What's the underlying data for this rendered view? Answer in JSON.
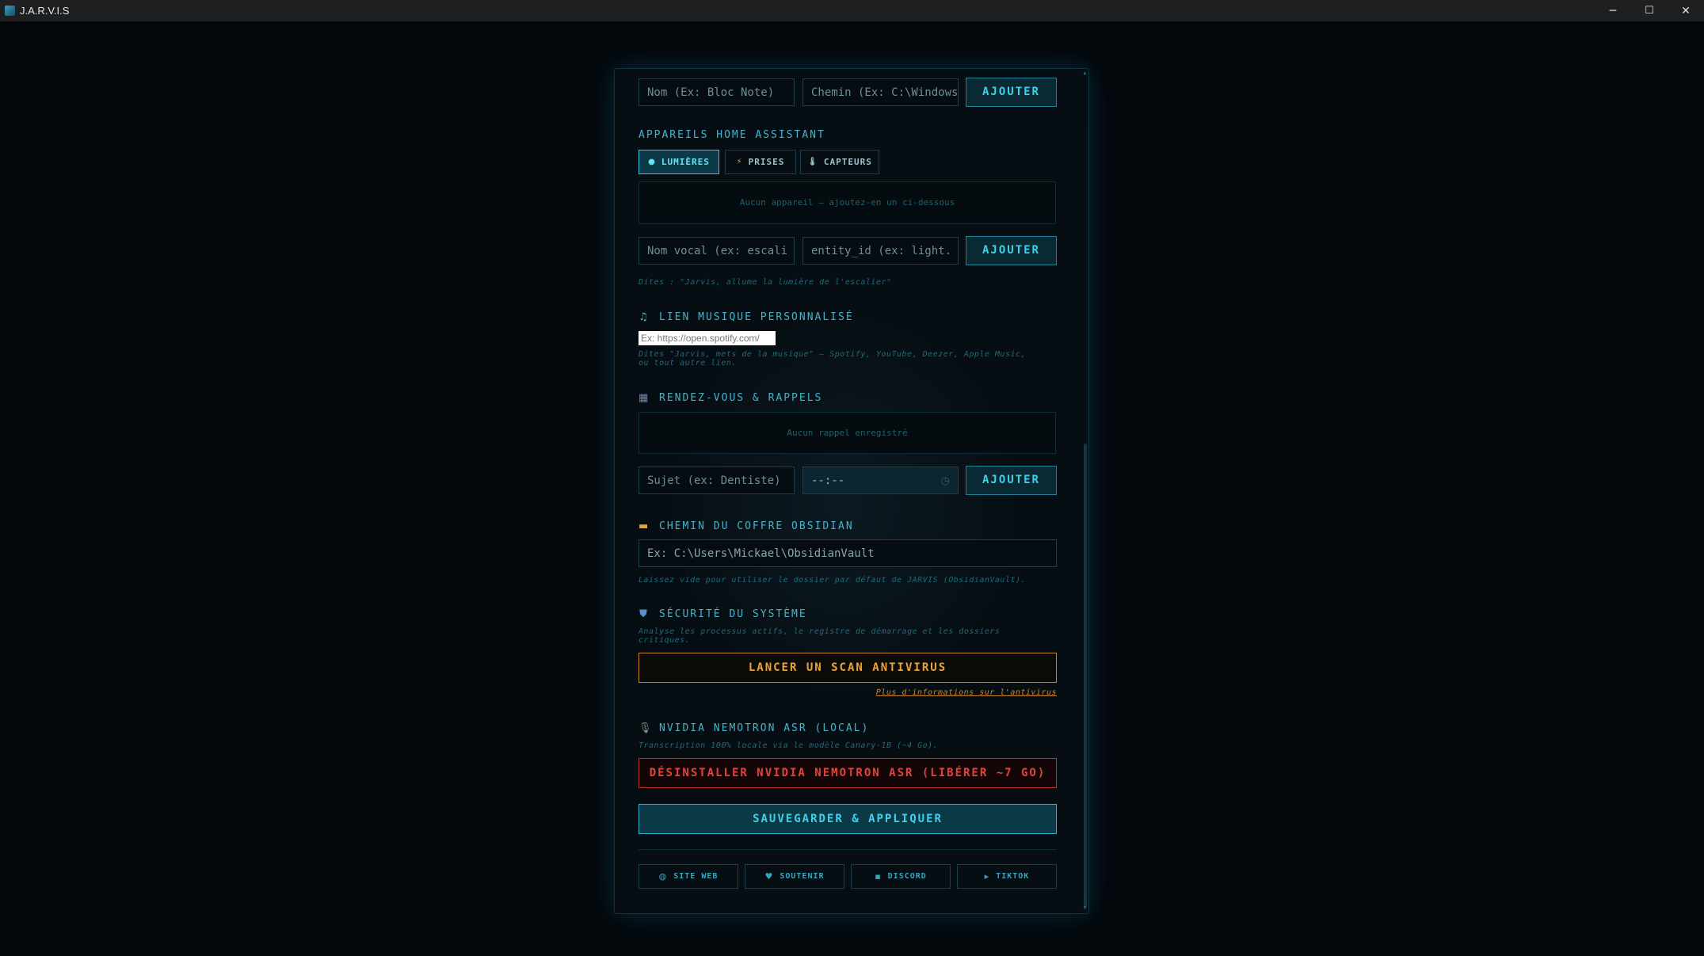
{
  "window": {
    "title": "J.A.R.V.I.S",
    "minimize": "─",
    "maximize": "☐",
    "close": "✕"
  },
  "apps": {
    "name_placeholder": "Nom (Ex: Bloc Note)",
    "path_placeholder": "Chemin (Ex: C:\\Windows",
    "add_label": "AJOUTER"
  },
  "home_assistant": {
    "title": "APPAREILS HOME ASSISTANT",
    "tabs": [
      {
        "icon": "●",
        "label": "LUMIÈRES"
      },
      {
        "icon": "⚡",
        "label": "PRISES"
      },
      {
        "icon": "🌡",
        "label": "CAPTEURS"
      }
    ],
    "empty_text": "Aucun appareil — ajoutez-en un ci-dessous",
    "voice_placeholder": "Nom vocal (ex: escali",
    "entity_placeholder": "entity_id (ex: light.",
    "add_label": "AJOUTER",
    "hint": "Dites : \"Jarvis, allume la lumière de l'escalier\""
  },
  "music": {
    "icon": "♫",
    "title": "LIEN MUSIQUE PERSONNALISÉ",
    "placeholder": "Ex: https://open.spotify.com/",
    "hint_line1": "Dites \"Jarvis, mets de la musique\" — Spotify, YouTube, Deezer, Apple Music,",
    "hint_line2": "ou tout autre lien."
  },
  "reminders": {
    "icon": "▦",
    "title": "RENDEZ-VOUS & RAPPELS",
    "empty_text": "Aucun rappel enregistré",
    "subject_placeholder": "Sujet (ex: Dentiste)",
    "time_placeholder": "--:--",
    "time_icon": "◷",
    "add_label": "AJOUTER"
  },
  "obsidian": {
    "icon": "▬",
    "title": "CHEMIN DU COFFRE OBSIDIAN",
    "placeholder": "Ex: C:\\Users\\Mickael\\ObsidianVault",
    "hint": "Laissez vide pour utiliser le dossier par défaut de JARVIS (ObsidianVault)."
  },
  "security": {
    "icon": "⛊",
    "title": "SÉCURITÉ DU SYSTÈME",
    "hint_line1": "Analyse les processus actifs, le registre de démarrage et les dossiers",
    "hint_line2": "critiques.",
    "scan_label": "LANCER UN SCAN ANTIVIRUS",
    "more_info": "Plus d'informations sur l'antivirus"
  },
  "asr": {
    "icon": "🎙",
    "title": "NVIDIA NEMOTRON ASR (LOCAL)",
    "hint": "Transcription 100% locale via le modèle Canary-1B (~4 Go).",
    "uninstall_label": "DÉSINSTALLER NVIDIA NEMOTRON ASR (LIBÉRER ~7 GO)"
  },
  "save_label": "SAUVEGARDER & APPLIQUER",
  "footer": [
    {
      "icon": "◍",
      "label": "SITE WEB"
    },
    {
      "icon": "♥",
      "label": "SOUTENIR"
    },
    {
      "icon": "▪",
      "label": "DISCORD"
    },
    {
      "icon": "▸",
      "label": "TIKTOK"
    }
  ],
  "colors": {
    "accent": "#3fd1ea",
    "warning": "#e8a33a",
    "danger": "#e0443c",
    "background": "#04080c"
  }
}
